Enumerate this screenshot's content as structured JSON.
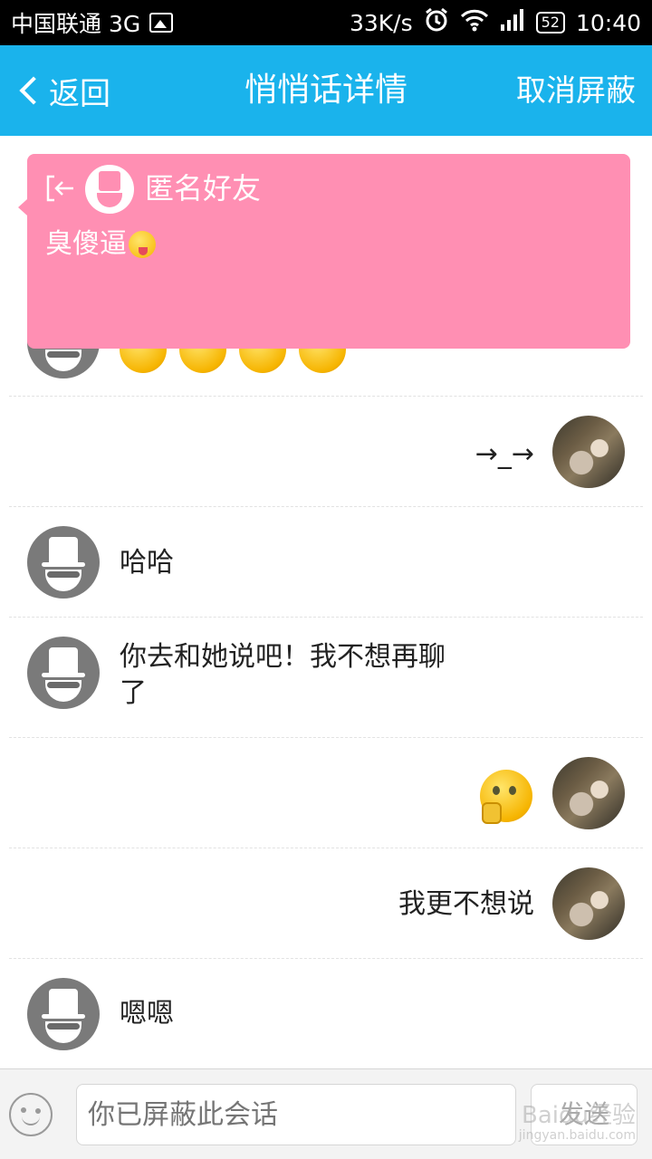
{
  "status_bar": {
    "carrier": "中国联通 3G",
    "net_speed": "33K/s",
    "battery": "52",
    "time": "10:40"
  },
  "header": {
    "back_label": "返回",
    "title": "悄悄话详情",
    "right_action": "取消屏蔽"
  },
  "messages": [
    {
      "side": "left",
      "type": "emoji",
      "content": "4 coin emojis"
    },
    {
      "side": "right",
      "type": "text",
      "text": "→_→"
    },
    {
      "side": "left",
      "type": "text",
      "text": "哈哈"
    },
    {
      "side": "left",
      "type": "text",
      "line1": "你去和她说吧！我不想再聊",
      "line2": "了"
    },
    {
      "side": "right",
      "type": "emoji",
      "content": "thinking-emoji"
    },
    {
      "side": "right",
      "type": "text",
      "text": "我更不想说"
    },
    {
      "side": "left",
      "type": "text",
      "text": "嗯嗯"
    }
  ],
  "popup": {
    "sender": "匿名好友",
    "message": "臭傻逼"
  },
  "input_bar": {
    "placeholder": "你已屏蔽此会话",
    "send_label": "发送"
  },
  "watermark": {
    "brand": "Baidu经验",
    "url": "jingyan.baidu.com"
  },
  "colors": {
    "header_bg": "#1ab3ec",
    "popup_bg": "#ff8fb3",
    "anon_avatar": "#7a7a7a"
  }
}
